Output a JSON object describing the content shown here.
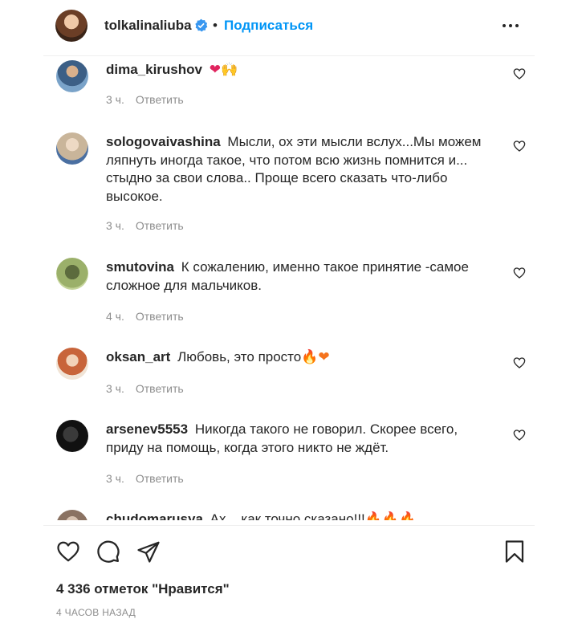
{
  "header": {
    "username": "tolkalinaliuba",
    "separator": "•",
    "follow_label": "Подписаться"
  },
  "comments": [
    {
      "user": "dima_kirushov",
      "text": "",
      "emoji": "❤🙌",
      "time": "3 ч.",
      "reply": "Ответить",
      "avatar_color": "#5b7fa6"
    },
    {
      "user": "sologovaivashina",
      "text": "Мысли, ох эти мысли вслух...Мы можем ляпнуть иногда такое, что потом всю жизнь помнится и... стыдно за свои слова.. Проще всего сказать что-либо высокое.",
      "emoji": "",
      "time": "3 ч.",
      "reply": "Ответить",
      "avatar_color": "#c9b59a"
    },
    {
      "user": "smutovina",
      "text": "К сожалению, именно такое принятие -самое сложное для мальчиков.",
      "emoji": "",
      "time": "4 ч.",
      "reply": "Ответить",
      "avatar_color": "#7d8f4e"
    },
    {
      "user": "oksan_art",
      "text": "Любовь, это просто",
      "emoji": "🔥❤",
      "time": "3 ч.",
      "reply": "Ответить",
      "avatar_color": "#d98a5e"
    },
    {
      "user": "arsenev5553",
      "text": "Никогда такого не говорил. Скорее всего, приду на помощь, когда этого никто не ждёт.",
      "emoji": "",
      "time": "3 ч.",
      "reply": "Ответить",
      "avatar_color": "#1a1a1a"
    },
    {
      "user": "chudomarusya",
      "text": "Ах... как точно сказано!!!",
      "emoji": "🔥🔥🔥",
      "time": "",
      "reply": "",
      "avatar_color": "#a08a78"
    }
  ],
  "actions": {
    "like_icon": "heart-icon",
    "comment_icon": "comment-icon",
    "share_icon": "paper-plane-icon",
    "save_icon": "bookmark-icon"
  },
  "likes_count": "4 336 отметок \"Нравится\"",
  "posted_ago": "4 ЧАСОВ НАЗАД",
  "colors": {
    "accent": "#0095f6",
    "text": "#262626",
    "muted": "#8e8e8e",
    "verified": "#3897f0"
  }
}
